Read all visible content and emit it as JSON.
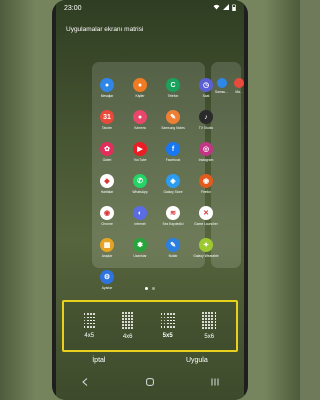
{
  "status_bar": {
    "time": "23:00",
    "icons": [
      "wifi-icon",
      "signal-icon",
      "battery-icon"
    ]
  },
  "page_title": "Uygulamalar ekranı matrisi",
  "apps": [
    {
      "label": "Mesajlar",
      "color": "#2d86e8",
      "glyph": "●"
    },
    {
      "label": "Kişiler",
      "color": "#f07b22",
      "glyph": "●"
    },
    {
      "label": "Telefon",
      "color": "#1aa15b",
      "glyph": "C"
    },
    {
      "label": "Saat",
      "color": "#5b5fd6",
      "glyph": "◷"
    },
    {
      "label": "Takvim",
      "color": "#e84a3c",
      "glyph": "31"
    },
    {
      "label": "Kamera",
      "color": "#e8466a",
      "glyph": "●"
    },
    {
      "label": "Samsung Notes",
      "color": "#ef7f32",
      "glyph": "✎"
    },
    {
      "label": "TV Studio",
      "color": "#2a2a2a",
      "glyph": "♪"
    },
    {
      "label": "Galeri",
      "color": "#e22e5a",
      "glyph": "✿"
    },
    {
      "label": "YouTube",
      "color": "#ec1c24",
      "glyph": "▶"
    },
    {
      "label": "Facebook",
      "color": "#1877f2",
      "glyph": "f"
    },
    {
      "label": "Instagram",
      "color": "#c13584",
      "glyph": "◎"
    },
    {
      "label": "Haritalar",
      "color": "#ffffff",
      "glyph": "◆"
    },
    {
      "label": "WhatsApp",
      "color": "#25d366",
      "glyph": "✆"
    },
    {
      "label": "Galaxy Store",
      "color": "#2b9cf2",
      "glyph": "◈"
    },
    {
      "label": "Firefox",
      "color": "#e25a1c",
      "glyph": "◉"
    },
    {
      "label": "Chrome",
      "color": "#ffffff",
      "glyph": "◉"
    },
    {
      "label": "Internet",
      "color": "#5a6ce3",
      "glyph": "◐"
    },
    {
      "label": "Ses Kaydedici",
      "color": "#ffffff",
      "glyph": "≋"
    },
    {
      "label": "Game Launcher",
      "color": "#ffffff",
      "glyph": "✕"
    },
    {
      "label": "Araçlar",
      "color": "#e5a423",
      "glyph": "▦"
    },
    {
      "label": "Uzantılar",
      "color": "#27a53a",
      "glyph": "❃"
    },
    {
      "label": "Notlar",
      "color": "#2a7fe0",
      "glyph": "✎"
    },
    {
      "label": "Galaxy Wearable",
      "color": "#9cc831",
      "glyph": "✦"
    },
    {
      "label": "Ayarlar",
      "color": "#2d74e0",
      "glyph": "⚙"
    }
  ],
  "second_page_apps": [
    {
      "label": "Samsu...",
      "color": "#2d86e8"
    },
    {
      "label": "Ma...",
      "color": "#e84a3c"
    }
  ],
  "options": [
    {
      "label": "4x5",
      "cols": 4,
      "rows": 5,
      "selected": false
    },
    {
      "label": "4x6",
      "cols": 4,
      "rows": 6,
      "selected": false
    },
    {
      "label": "5x5",
      "cols": 5,
      "rows": 5,
      "selected": true
    },
    {
      "label": "5x6",
      "cols": 5,
      "rows": 6,
      "selected": false
    }
  ],
  "actions": {
    "cancel": "İptal",
    "apply": "Uygula"
  },
  "nav": {
    "back": "back-icon",
    "home": "home-icon",
    "recents": "recents-icon"
  },
  "colors": {
    "highlight": "#e8d11c"
  }
}
